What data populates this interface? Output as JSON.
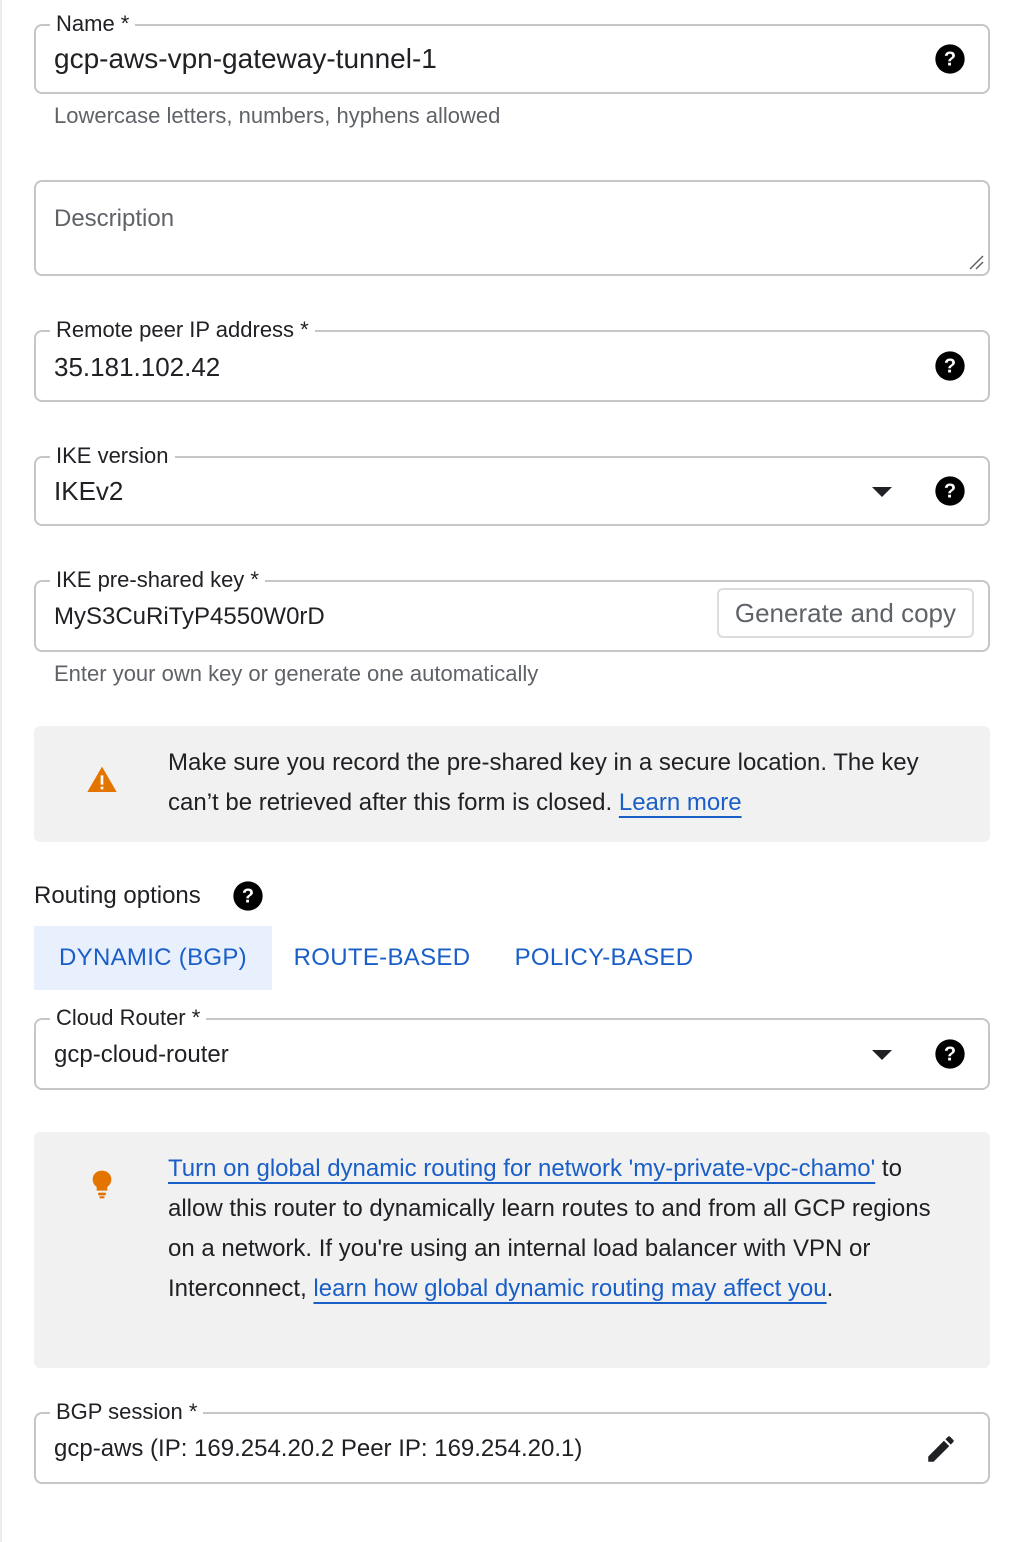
{
  "form": {
    "name": {
      "label": "Name *",
      "value": "gcp-aws-vpn-gateway-tunnel-1",
      "hint": "Lowercase letters, numbers, hyphens allowed",
      "help_icon": "help-circle-icon"
    },
    "description": {
      "placeholder": "Description"
    },
    "remote_peer_ip": {
      "label": "Remote peer IP address *",
      "value": "35.181.102.42",
      "help_icon": "help-circle-icon"
    },
    "ike_version": {
      "label": "IKE version",
      "value": "IKEv2",
      "dropdown_icon": "caret-down-icon",
      "help_icon": "help-circle-icon"
    },
    "ike_psk": {
      "label": "IKE pre-shared key *",
      "value": "MyS3CuRiTyP4550W0rD",
      "button": "Generate and copy",
      "hint": "Enter your own key or generate one automatically"
    },
    "psk_warning": {
      "icon": "warning-icon",
      "icon_color": "#e37400",
      "text": "Make sure you record the pre-shared key in a secure location. The key can’t be retrieved after this form is closed. ",
      "link": "Learn more"
    },
    "routing": {
      "title": "Routing options",
      "help_icon": "help-circle-icon",
      "tabs": [
        {
          "label": "DYNAMIC (BGP)",
          "selected": true
        },
        {
          "label": "ROUTE-BASED",
          "selected": false
        },
        {
          "label": "POLICY-BASED",
          "selected": false
        }
      ]
    },
    "cloud_router": {
      "label": "Cloud Router *",
      "value": "gcp-cloud-router",
      "dropdown_icon": "caret-down-icon",
      "help_icon": "help-circle-icon"
    },
    "global_routing_tip": {
      "icon": "lightbulb-icon",
      "icon_color": "#e37400",
      "link1": "Turn on global dynamic routing for network 'my-private-vpc-chamo'",
      "text1": " to allow this router to dynamically learn routes to and from all GCP regions on a network. If you're using an internal load balancer with VPN or Interconnect, ",
      "link2": "learn how global dynamic routing may affect you",
      "text2": "."
    },
    "bgp_session": {
      "label": "BGP session *",
      "value": "gcp-aws (IP: 169.254.20.2 Peer IP: 169.254.20.1)",
      "edit_icon": "pencil-edit-icon"
    }
  },
  "colors": {
    "accent": "#1a5fc7",
    "tab_selected_bg": "#e8f0fe",
    "notice_bg": "#f1f1f1",
    "warning": "#e37400"
  }
}
